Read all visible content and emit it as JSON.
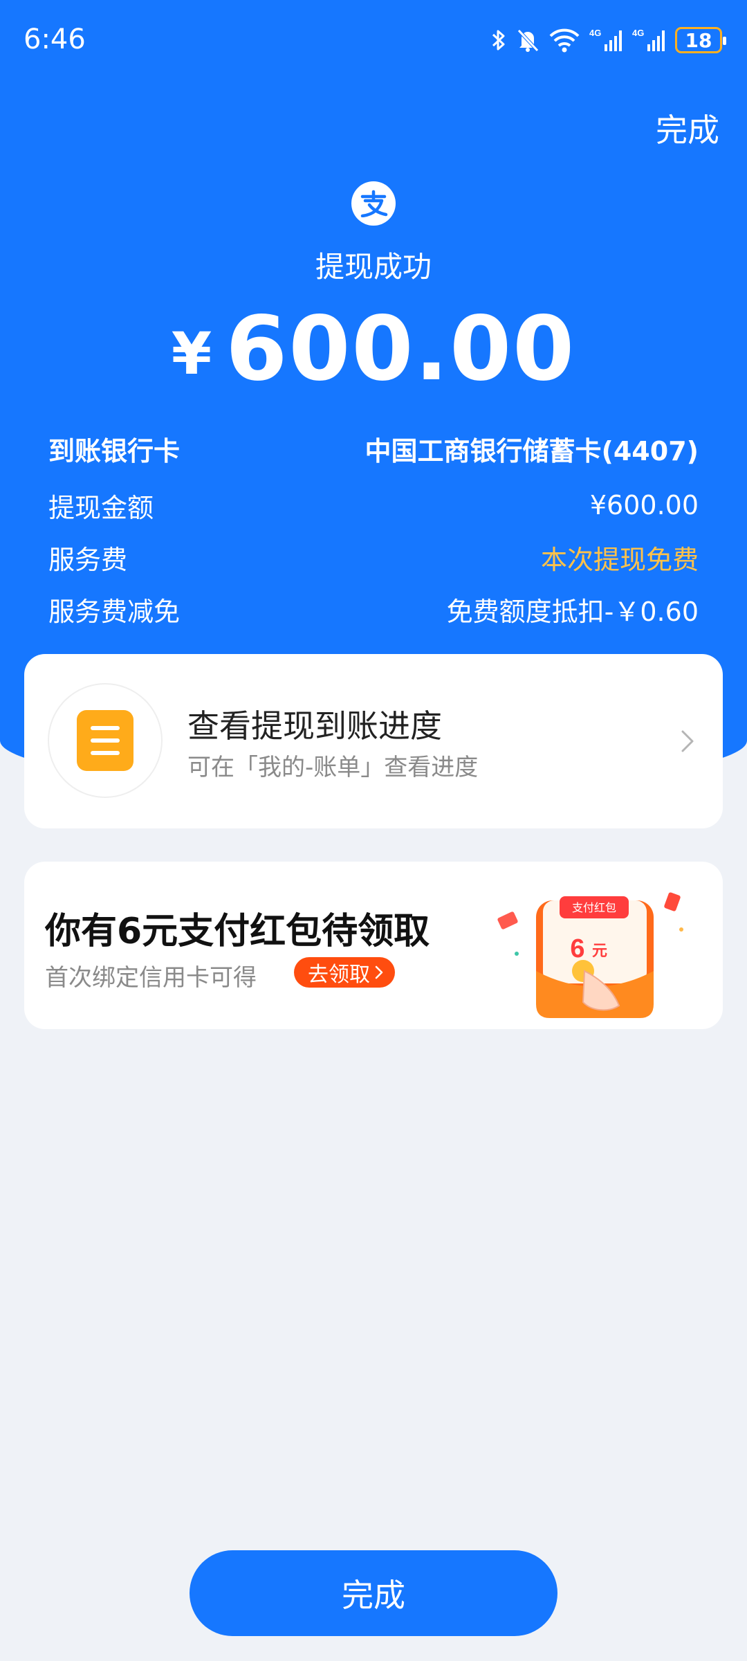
{
  "status_bar": {
    "time": "6:46",
    "battery": "18",
    "network_1": "4G",
    "network_2": "4G"
  },
  "header": {
    "done_label": "完成",
    "title": "提现成功",
    "currency_symbol": "¥",
    "amount": "600.00"
  },
  "details": [
    {
      "label": "到账银行卡",
      "value": "中国工商银行储蓄卡(4407)"
    },
    {
      "label": "提现金额",
      "value": "¥600.00"
    },
    {
      "label": "服务费",
      "value": "本次提现免费"
    },
    {
      "label": "服务费减免",
      "value": "免费额度抵扣-￥0.60"
    }
  ],
  "progress_card": {
    "title": "查看提现到账进度",
    "subtitle": "可在「我的-账单」查看进度"
  },
  "promo_card": {
    "title": "你有6元支付红包待领取",
    "subtitle": "首次绑定信用卡可得",
    "button_label": "去领取",
    "art_tag": "支付红包",
    "art_amount": "6",
    "art_unit": "元"
  },
  "footer": {
    "done_button": "完成"
  },
  "colors": {
    "primary": "#1677ff",
    "highlight": "#ffc24a",
    "promo_button": "#ff4d0f",
    "background": "#eff2f7"
  },
  "icons": [
    "bluetooth-icon",
    "mute-icon",
    "wifi-icon",
    "signal-icon",
    "battery-icon",
    "alipay-logo-icon",
    "list-doc-icon",
    "chevron-right-icon",
    "red-packet-illustration"
  ]
}
